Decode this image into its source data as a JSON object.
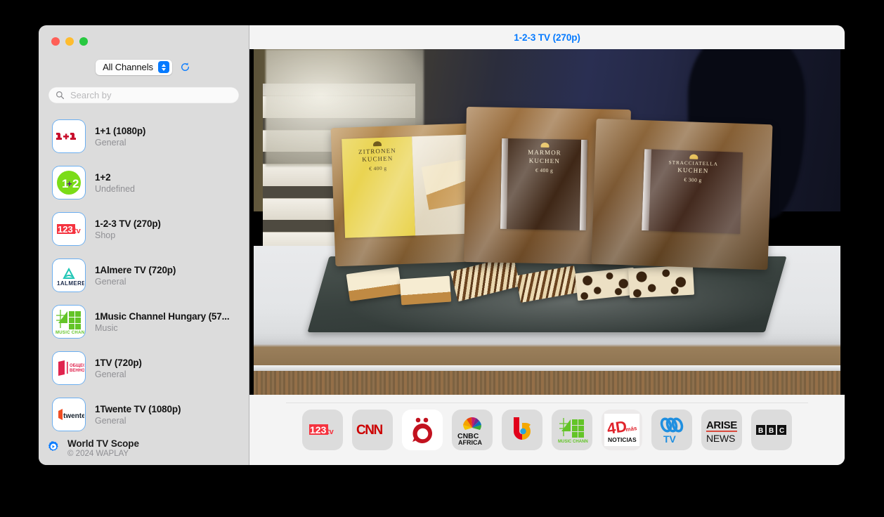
{
  "window": {
    "traffic_lights": [
      "close",
      "minimize",
      "zoom"
    ],
    "colors": {
      "accent": "#057aff",
      "sidebar_bg": "#dcdcdc",
      "main_bg": "#f4f4f4",
      "close": "#ff5f57",
      "minimize": "#febc2e",
      "zoom": "#28c840"
    }
  },
  "sidebar": {
    "filter": {
      "label": "All Channels",
      "refresh_icon": "refresh-icon"
    },
    "search": {
      "placeholder": "Search by",
      "value": "",
      "icon": "search-icon"
    },
    "channels": [
      {
        "name": "1+1 (1080p)",
        "genre": "General",
        "logo": "1plus1-logo"
      },
      {
        "name": "1+2",
        "genre": "Undefined",
        "logo": "1plus2-logo"
      },
      {
        "name": "1-2-3 TV (270p)",
        "genre": "Shop",
        "logo": "123tv-logo"
      },
      {
        "name": "1Almere TV (720p)",
        "genre": "General",
        "logo": "1almere-logo"
      },
      {
        "name": "1Music Channel Hungary (57...",
        "genre": "Music",
        "logo": "1music-logo"
      },
      {
        "name": "1TV (720p)",
        "genre": "General",
        "logo": "1tv-logo"
      },
      {
        "name": "1Twente TV (1080p)",
        "genre": "General",
        "logo": "1twente-logo"
      }
    ],
    "footer": {
      "app_name": "World TV Scope",
      "copyright": "© 2024 WAPLAY",
      "icon": "app-gear-play-icon"
    }
  },
  "player": {
    "title": "1-2-3 TV (270p)",
    "video": {
      "description": "Television shopping broadcast showing packaged German cakes on a kitchen counter",
      "package_labels": [
        {
          "line1": "ZITRONEN",
          "line2": "KUCHEN",
          "weight": "€ 400 g"
        },
        {
          "line1": "MARMOR",
          "line2": "KUCHEN",
          "weight": "€ 400 g"
        },
        {
          "line1": "STRACCIATELLA",
          "line2": "KUCHEN",
          "weight": "€ 300 g"
        }
      ]
    }
  },
  "favorites": [
    {
      "name": "1-2-3 TV",
      "logo": "123tv-logo"
    },
    {
      "name": "CNN",
      "logo": "cnn-logo"
    },
    {
      "name": "Kanal O",
      "logo": "kanal-o-logo"
    },
    {
      "name": "CNBC Africa",
      "logo": "cnbc-africa-logo"
    },
    {
      "name": "b TV",
      "logo": "btv-logo"
    },
    {
      "name": "1Music Channel",
      "logo": "1music-logo"
    },
    {
      "name": "4D Más Noticias",
      "logo": "4d-noticias-logo"
    },
    {
      "name": "ABC TV",
      "logo": "abc-tv-logo"
    },
    {
      "name": "Arise News",
      "logo": "arise-news-logo"
    },
    {
      "name": "BBC",
      "logo": "bbc-logo"
    }
  ]
}
